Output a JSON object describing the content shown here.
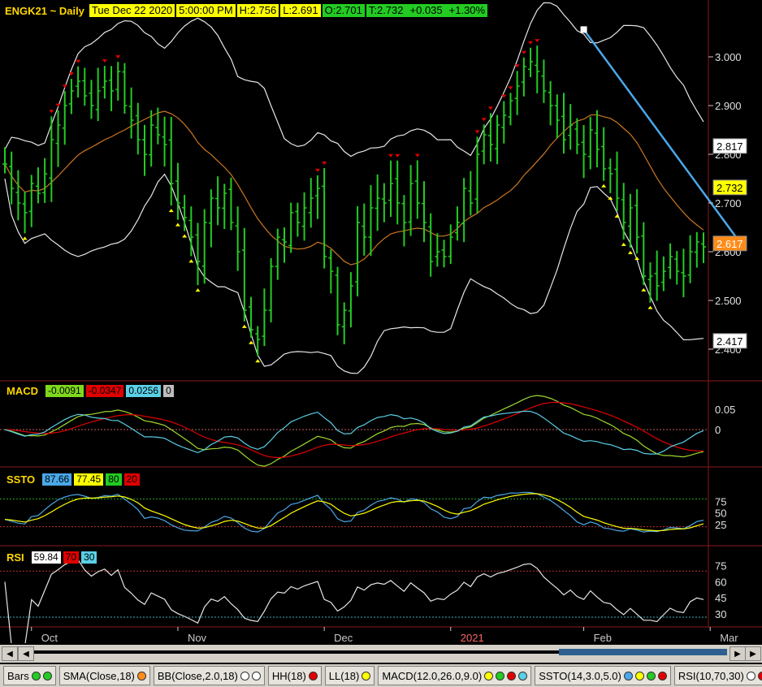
{
  "header": {
    "symbol": "ENGK21 ~ Daily",
    "date": "Tue Dec 22 2020",
    "time": "5:00:00 PM",
    "high": "H:2.756",
    "low": "L:2.691",
    "open": "O:2.701",
    "close": "T:2.732",
    "change": "+0.035",
    "change_pct": "+1.30%"
  },
  "price_axis": {
    "ticks": [
      "3.000",
      "2.900",
      "2.800",
      "2.700",
      "2.600",
      "2.500",
      "2.400"
    ],
    "tick_values": [
      3.0,
      2.9,
      2.8,
      2.7,
      2.6,
      2.5,
      2.4
    ],
    "markers": [
      {
        "label": "2.817",
        "value": 2.817,
        "bg": "#ffffff",
        "fg": "#000000"
      },
      {
        "label": "2.732",
        "value": 2.732,
        "bg": "#ffff00",
        "fg": "#000000"
      },
      {
        "label": "2.617",
        "value": 2.617,
        "bg": "#ff8c1a",
        "fg": "#ffffff"
      },
      {
        "label": "2.417",
        "value": 2.417,
        "bg": "#ffffff",
        "fg": "#000000"
      }
    ]
  },
  "macd": {
    "label": "MACD",
    "values": [
      {
        "text": "-0.0091",
        "bg": "#7fd81c",
        "fg": "#000000"
      },
      {
        "text": "-0.0347",
        "bg": "#e00000",
        "fg": "#000000"
      },
      {
        "text": "0.0256",
        "bg": "#5ad0e6",
        "fg": "#000000"
      },
      {
        "text": "0",
        "bg": "#bdbdbd",
        "fg": "#000000"
      }
    ],
    "ticks": [
      "0.05",
      "0"
    ]
  },
  "ssto": {
    "label": "SSTO",
    "values": [
      {
        "text": "87.66",
        "bg": "#4aa8e8",
        "fg": "#000000"
      },
      {
        "text": "77.45",
        "bg": "#ffff00",
        "fg": "#000000"
      },
      {
        "text": "80",
        "bg": "#22cc22",
        "fg": "#000000"
      },
      {
        "text": "20",
        "bg": "#e00000",
        "fg": "#000000"
      }
    ],
    "ticks": [
      "75",
      "50",
      "25"
    ]
  },
  "rsi": {
    "label": "RSI",
    "values": [
      {
        "text": "59.84",
        "bg": "#ffffff",
        "fg": "#000000"
      },
      {
        "text": "70",
        "bg": "#e00000",
        "fg": "#000000"
      },
      {
        "text": "30",
        "bg": "#5ad0e6",
        "fg": "#000000"
      }
    ],
    "ticks": [
      "75",
      "60",
      "45",
      "30"
    ]
  },
  "time_axis": {
    "labels": [
      {
        "text": "Oct",
        "color": "#c8c8c8",
        "bar": 4
      },
      {
        "text": "Nov",
        "color": "#c8c8c8",
        "bar": 26
      },
      {
        "text": "Dec",
        "color": "#c8c8c8",
        "bar": 48
      },
      {
        "text": "2021",
        "color": "#ff6666",
        "bar": 67
      },
      {
        "text": "Feb",
        "color": "#c8c8c8",
        "bar": 87
      },
      {
        "text": "Mar",
        "color": "#c8c8c8",
        "bar": 106
      }
    ]
  },
  "scrollbar": {
    "left_arrow": "◀",
    "right_arrow": "▶"
  },
  "toolbar": [
    {
      "label": "Bars",
      "dots": [
        "#22cc22",
        "#22cc22"
      ]
    },
    {
      "label": "SMA(Close,18)",
      "dots": [
        "#ff8c1a"
      ]
    },
    {
      "label": "BB(Close,2.0,18)",
      "dots": [
        "#ffffff",
        "#ffffff"
      ]
    },
    {
      "label": "HH(18)",
      "dots": [
        "#e00000"
      ]
    },
    {
      "label": "LL(18)",
      "dots": [
        "#ffff00"
      ]
    },
    {
      "label": "MACD(12.0,26.0,9.0)",
      "dots": [
        "#ffff00",
        "#22cc22",
        "#e00000",
        "#5ad0e6"
      ]
    },
    {
      "label": "SSTO(14,3.0,5.0)",
      "dots": [
        "#4aa8e8",
        "#ffff00",
        "#22cc22",
        "#e00000"
      ]
    },
    {
      "label": "RSI(10,70,30)",
      "dots": [
        "#ffffff",
        "#e00000",
        "#5ad0e6"
      ]
    }
  ],
  "colors": {
    "bars": "#22cc22",
    "sma": "#cc7722",
    "bb": "#e6e6e6",
    "trendline": "#4aa8e8",
    "hh_marker": "#e00000",
    "ll_marker": "#ffff00",
    "separator": "#8b1a1a"
  },
  "chart_data": {
    "type": "line",
    "closes": [
      2.78,
      2.73,
      2.7,
      2.68,
      2.74,
      2.72,
      2.76,
      2.83,
      2.86,
      2.9,
      2.93,
      2.95,
      2.92,
      2.9,
      2.93,
      2.95,
      2.93,
      2.97,
      2.9,
      2.87,
      2.83,
      2.8,
      2.86,
      2.84,
      2.82,
      2.74,
      2.7,
      2.67,
      2.63,
      2.58,
      2.66,
      2.71,
      2.69,
      2.72,
      2.66,
      2.6,
      2.48,
      2.44,
      2.42,
      2.48,
      2.57,
      2.63,
      2.62,
      2.68,
      2.66,
      2.69,
      2.71,
      2.73,
      2.59,
      2.56,
      2.45,
      2.48,
      2.53,
      2.66,
      2.63,
      2.69,
      2.71,
      2.7,
      2.74,
      2.7,
      2.66,
      2.74,
      2.7,
      2.66,
      2.58,
      2.6,
      2.59,
      2.63,
      2.66,
      2.73,
      2.7,
      2.8,
      2.84,
      2.82,
      2.86,
      2.88,
      2.91,
      2.94,
      2.98,
      2.99,
      2.97,
      2.93,
      2.9,
      2.87,
      2.83,
      2.86,
      2.82,
      2.8,
      2.85,
      2.81,
      2.77,
      2.76,
      2.71,
      2.66,
      2.69,
      2.63,
      2.55,
      2.55,
      2.53,
      2.56,
      2.59,
      2.56,
      2.55,
      2.6,
      2.62,
      2.61
    ],
    "trendline": [
      [
        87,
        3.056
      ],
      [
        110,
        2.628
      ]
    ]
  }
}
